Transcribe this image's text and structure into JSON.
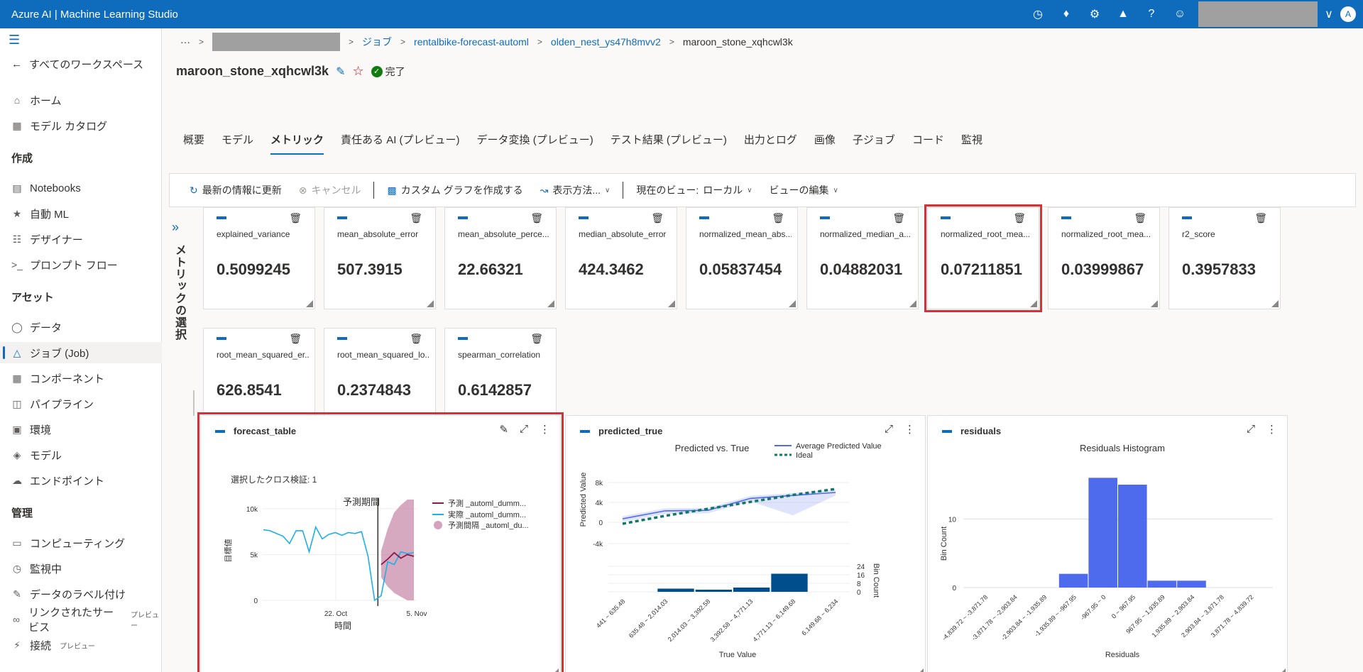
{
  "app": {
    "title": "Azure AI | Machine Learning Studio"
  },
  "topbar": {
    "icons": [
      "clock-icon",
      "bell-icon",
      "gear-icon",
      "megaphone-icon",
      "help-icon",
      "smiley-icon"
    ],
    "avatar": "A"
  },
  "sidebar": {
    "back": "すべてのワークスペース",
    "home": "ホーム",
    "catalog": "モデル カタログ",
    "section_create": "作成",
    "notebooks": "Notebooks",
    "automl": "自動 ML",
    "designer": "デザイナー",
    "promptflow": "プロンプト フロー",
    "section_assets": "アセット",
    "data": "データ",
    "jobs": "ジョブ (Job)",
    "components": "コンポーネント",
    "pipelines": "パイプライン",
    "environments": "環境",
    "models": "モデル",
    "endpoints": "エンドポイント",
    "section_manage": "管理",
    "compute": "コンピューティング",
    "monitoring": "監視中",
    "labeling": "データのラベル付け",
    "linked": "リンクされたサービス",
    "linked_tag": "プレビュー",
    "connections": "接続",
    "connections_tag": "プレビュー"
  },
  "breadcrumb": {
    "more": "···",
    "jobs": "ジョブ",
    "experiment": "rentalbike-forecast-automl",
    "parent": "olden_nest_ys47h8mvv2",
    "current": "maroon_stone_xqhcwl3k"
  },
  "page": {
    "title": "maroon_stone_xqhcwl3k",
    "status": "完了"
  },
  "tabs": [
    "概要",
    "モデル",
    "メトリック",
    "責任ある AI (プレビュー)",
    "データ変換 (プレビュー)",
    "テスト結果 (プレビュー)",
    "出力とログ",
    "画像",
    "子ジョブ",
    "コード",
    "監視"
  ],
  "toolbar": {
    "refresh": "最新の情報に更新",
    "cancel": "キャンセル",
    "custom_chart": "カスタム グラフを作成する",
    "display": "表示方法...",
    "current_view_label": "現在のビュー:",
    "current_view": "ローカル",
    "edit_view": "ビューの編集"
  },
  "metrics_panel": {
    "label": "メトリックの選択"
  },
  "metrics": [
    {
      "name": "explained_variance",
      "value": "0.5099245"
    },
    {
      "name": "mean_absolute_error",
      "value": "507.3915"
    },
    {
      "name": "mean_absolute_perce...",
      "value": "22.66321"
    },
    {
      "name": "median_absolute_error",
      "value": "424.3462"
    },
    {
      "name": "normalized_mean_abs...",
      "value": "0.05837454"
    },
    {
      "name": "normalized_median_a...",
      "value": "0.04882031"
    },
    {
      "name": "normalized_root_mea...",
      "value": "0.07211851"
    },
    {
      "name": "normalized_root_mea...",
      "value": "0.03999867"
    },
    {
      "name": "r2_score",
      "value": "0.3957833"
    },
    {
      "name": "root_mean_squared_er...",
      "value": "626.8541"
    },
    {
      "name": "root_mean_squared_lo...",
      "value": "0.2374843"
    },
    {
      "name": "spearman_correlation",
      "value": "0.6142857"
    }
  ],
  "chart_data": [
    {
      "type": "line",
      "card_title": "forecast_table",
      "subtitle": "選択したクロス検証: 1",
      "title": "予測期間",
      "xlabel": "時間",
      "ylabel": "目標値",
      "x_ticks": [
        "22. Oct",
        "5. Nov"
      ],
      "y_ticks": [
        "0",
        "5k",
        "10k"
      ],
      "ylim": [
        0,
        11000
      ],
      "legend": [
        "予測 _automl_dumm...",
        "実際 _automl_dumm...",
        "予測間隔 _automl_du..."
      ],
      "series": [
        {
          "name": "実際 _automl_dumm...",
          "color": "#1bb0e8",
          "values": [
            7700,
            7600,
            7300,
            7000,
            6200,
            7600,
            7600,
            5300,
            8000,
            6700,
            7200,
            7400,
            7100,
            7400,
            7300,
            7500,
            4800,
            0,
            500,
            4200,
            3900,
            5300,
            5100,
            5200
          ]
        },
        {
          "name": "予測 _automl_dumm...",
          "color": "#8b1a4a",
          "values": [
            3900,
            4500,
            5200,
            4600,
            5000,
            4800
          ]
        }
      ],
      "interval": {
        "name": "予測間隔 _automl_du...",
        "color": "#c27ba0",
        "upper": [
          5400,
          7800,
          9600,
          10400,
          11000,
          11200
        ],
        "lower": [
          2500,
          1500,
          800,
          400,
          0,
          0
        ]
      }
    },
    {
      "type": "line",
      "card_title": "predicted_true",
      "title": "Predicted vs. True",
      "xlabel": "True Value",
      "ylabel": "Predicted Value",
      "y2label": "Bin Count",
      "categories": [
        "441 ~ 635.48",
        "635.48 ~ 2,014.03",
        "2,014.03 ~ 3,392.58",
        "3,392.58 ~ 4,771.13",
        "4,771.13 ~ 6,149.68",
        "6,149.68 ~ 6,234"
      ],
      "y_ticks": [
        "-4k",
        "0",
        "4k",
        "8k"
      ],
      "y2_ticks": [
        "0",
        "8",
        "16",
        "24"
      ],
      "ylim": [
        -4000,
        8000
      ],
      "legend": [
        "Average Predicted Value",
        "Ideal"
      ],
      "series": [
        {
          "name": "Average Predicted Value",
          "color": "#4f6bed",
          "values": [
            700,
            2300,
            2400,
            4800,
            5400,
            6000
          ]
        },
        {
          "name": "Ideal",
          "color": "#117865",
          "values": [
            -300,
            1300,
            2700,
            4100,
            5500,
            6700
          ]
        }
      ],
      "bin_counts": [
        0,
        3,
        2,
        4,
        17,
        0
      ]
    },
    {
      "type": "bar",
      "card_title": "residuals",
      "title": "Residuals Histogram",
      "xlabel": "Residuals",
      "ylabel": "Bin Count",
      "y_ticks": [
        "0",
        "10"
      ],
      "ylim": [
        0,
        18
      ],
      "categories": [
        "-4,839.72 ~ -3,871.78",
        "-3,871.78 ~ -2,903.84",
        "-2,903.84 ~ -1,935.89",
        "-1,935.89 ~ -967.95",
        "-967.95 ~ 0",
        "0 ~ 967.95",
        "967.95 ~ 1,935.89",
        "1,935.89 ~ 2,903.84",
        "2,903.84 ~ 3,871.78",
        "3,871.78 ~ 4,839.72"
      ],
      "values": [
        0,
        0,
        0,
        2,
        16,
        15,
        1,
        1,
        0,
        0
      ],
      "color": "#4f6bed"
    }
  ]
}
